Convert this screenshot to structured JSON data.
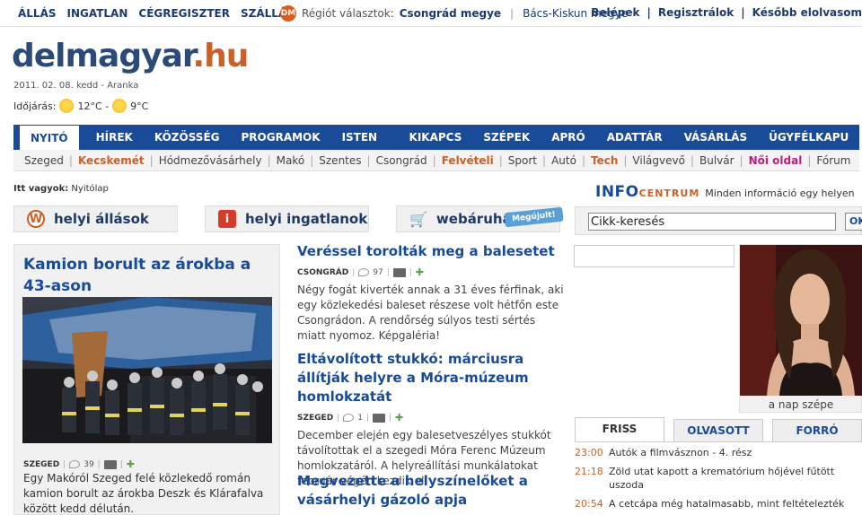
{
  "topbar": {
    "links": [
      "ÁLLÁS",
      "INGATLAN",
      "CÉGREGISZTER",
      "SZÁLLÁS"
    ],
    "region_label": "Régiót választok:",
    "region_selected": "Csongrád megye",
    "region_alt": "Bács-Kiskun megye",
    "login": "Belépek",
    "register": "Regisztrálok",
    "later": "Később elolvasom"
  },
  "brand": {
    "name": "delmagyar",
    "tld": ".hu"
  },
  "date": "2011. 02. 08. kedd - Aranka",
  "weather": {
    "label": "Időjárás:",
    "temp1": "12°C -",
    "temp2": "9°C"
  },
  "mainnav": [
    "NYITÓ",
    "HÍREK",
    "KÖZÖSSÉG",
    "PROGRAMOK",
    "ISTEN HOZTA!",
    "KIKAPCS",
    "SZÉPEK SZÉPE",
    "APRÓ",
    "ADATTÁR",
    "VÁSÁRLÁS",
    "ÜGYFÉLKAPU"
  ],
  "subnav": [
    {
      "label": "Szeged",
      "style": "normal"
    },
    {
      "label": "Kecskemét",
      "style": "hi"
    },
    {
      "label": "Hódmezővásárhely",
      "style": "normal"
    },
    {
      "label": "Makó",
      "style": "normal"
    },
    {
      "label": "Szentes",
      "style": "normal"
    },
    {
      "label": "Csongrád",
      "style": "normal"
    },
    {
      "label": "Felvételi",
      "style": "hi"
    },
    {
      "label": "Sport",
      "style": "normal"
    },
    {
      "label": "Autó",
      "style": "normal"
    },
    {
      "label": "Tech",
      "style": "hi"
    },
    {
      "label": "Világvevő",
      "style": "normal"
    },
    {
      "label": "Bulvár",
      "style": "normal"
    },
    {
      "label": "Női oldal",
      "style": "pink"
    },
    {
      "label": "Fórum",
      "style": "normal"
    }
  ],
  "breadcrumb": {
    "prefix": "Itt vagyok:",
    "page": "Nyitólap"
  },
  "promos": {
    "jobs": "helyi állások",
    "realestate": "helyi ingatlanok",
    "shop": "webáruház",
    "shop_tag": "Megújult!"
  },
  "feature": {
    "title": "Kamion borult az árokba a 43-ason",
    "city": "SZEGED",
    "comments": "39",
    "lead": "Egy Makóról Szeged felé közlekedő román kamion borult az árokba Deszk és Klárafalva között kedd délután."
  },
  "articles": [
    {
      "title": "Veréssel torolták meg a balesetet",
      "city": "CSONGRÁD",
      "comments": "97",
      "lead": "Négy fogát kiverték annak a 31 éves férfinak, aki egy közlekedési baleset részese volt hétfőn este Csongrádon. A rendőrség súlyos testi sértés miatt nyomoz. Képgaléria!"
    },
    {
      "title": "Eltávolított stukkó: márciusra állítják helyre a Móra-múzeum homlokzatát",
      "city": "SZEGED",
      "comments": "1",
      "lead": "December elején egy balesetveszélyes stukkót távolítottak el a szegedi Móra Ferenc Múzeum homlokzatáról. A helyreállítási munkálatokat február végén kezdik el."
    },
    {
      "title": "Megvezette a helyszínelőket a vásárhelyi gázoló apja",
      "city": "",
      "comments": "",
      "lead": ""
    }
  ],
  "infocentrum": {
    "logo_main": "INFO",
    "logo_sub": "CENTRUM",
    "desc": "Minden információ egy helyen"
  },
  "search": {
    "value": "Cikk-keresés",
    "button": "OK"
  },
  "beauty": {
    "caption": "a nap szépe"
  },
  "tabs": [
    "FRISS",
    "OLVASOTT",
    "FORRÓ"
  ],
  "news": [
    {
      "time": "23:00",
      "title": "Autók a filmvásznon - 4. rész"
    },
    {
      "time": "21:18",
      "title": "Zöld utat kapott a krematórium hőjével fűtött uszoda"
    },
    {
      "time": "20:54",
      "title": "A cetcápa még hatalmasabb, mint feltételezték"
    }
  ],
  "colors": {
    "nav": "#1a4b99",
    "accent": "#c8612a",
    "pink": "#b8207a"
  }
}
